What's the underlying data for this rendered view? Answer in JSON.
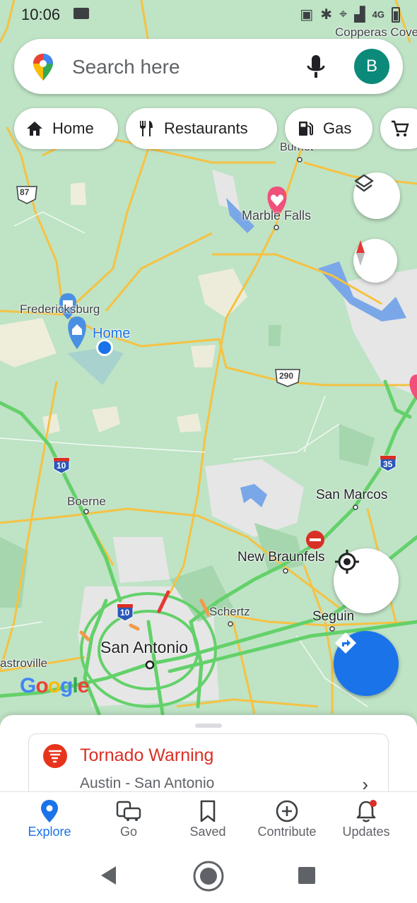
{
  "status": {
    "time": "10:06",
    "network": "4G"
  },
  "search": {
    "placeholder": "Search here",
    "avatar_letter": "B"
  },
  "chips": [
    {
      "label": "Home",
      "icon": "home-icon"
    },
    {
      "label": "Restaurants",
      "icon": "fork-knife-icon"
    },
    {
      "label": "Gas",
      "icon": "gas-pump-icon"
    },
    {
      "label": "",
      "icon": "shopping-cart-icon"
    }
  ],
  "map": {
    "labels": {
      "copperas_cove": "Copperas Cove",
      "burnet": "Burnet",
      "marble_falls": "Marble Falls",
      "fredericksburg": "Fredericksburg",
      "home": "Home",
      "boerne": "Boerne",
      "san_marcos": "San Marcos",
      "new_braunfels": "New Braunfels",
      "schertz": "Schertz",
      "seguin": "Seguin",
      "san_antonio": "San Antonio",
      "castroville": "astroville"
    },
    "shields": {
      "us87": "87",
      "us290": "290",
      "i10_west": "10",
      "i10_sa": "10",
      "i35": "35"
    },
    "logo": "Google"
  },
  "alert": {
    "title": "Tornado Warning",
    "subtitle": "Austin - San Antonio"
  },
  "nav": [
    {
      "label": "Explore",
      "icon": "explore-pin-icon",
      "active": true
    },
    {
      "label": "Go",
      "icon": "car-bus-icon"
    },
    {
      "label": "Saved",
      "icon": "bookmark-icon"
    },
    {
      "label": "Contribute",
      "icon": "add-circle-icon"
    },
    {
      "label": "Updates",
      "icon": "bell-icon"
    }
  ],
  "colors": {
    "accent": "#1a73e8",
    "alert": "#d93025",
    "traffic": "#63d16a",
    "road": "#f5c242"
  }
}
